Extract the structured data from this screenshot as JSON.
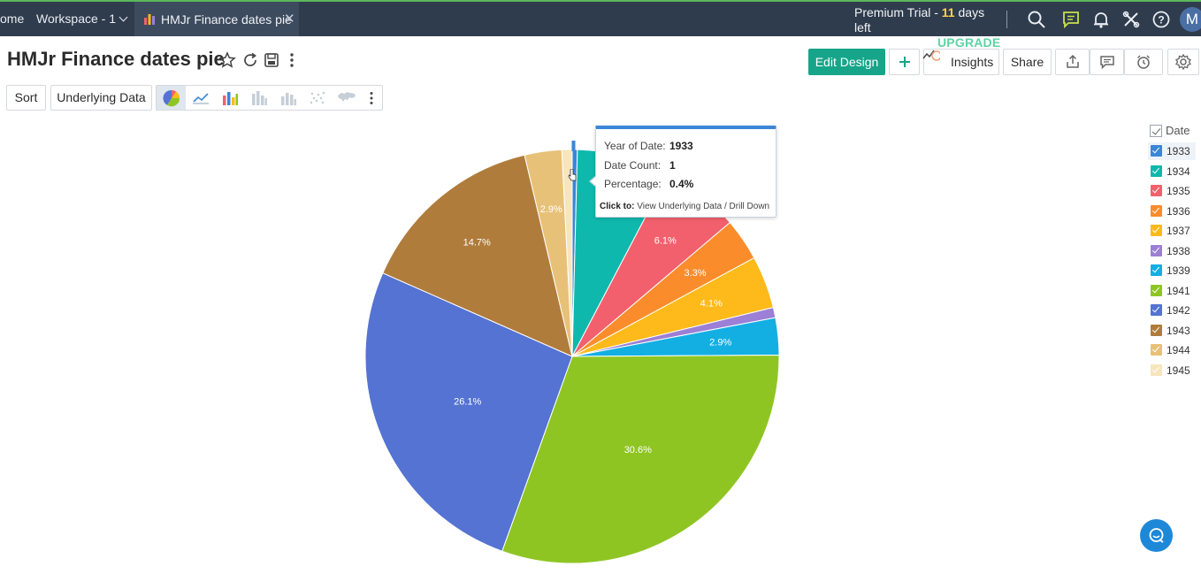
{
  "topbar": {
    "home_label": "ome",
    "workspace_label": "Workspace - 1",
    "tab_label": "HMJr Finance dates pie",
    "trial_prefix": "Premium Trial - ",
    "trial_days": "11",
    "trial_suffix": " days left",
    "upgrade_label": "UPGRADE",
    "avatar_letter": "M"
  },
  "header": {
    "title": "HMJr Finance dates pie",
    "edit_design_label": "Edit Design",
    "insights_label": "Insights",
    "share_label": "Share"
  },
  "toolbar": {
    "sort_label": "Sort",
    "underlying_data_label": "Underlying Data"
  },
  "tooltip": {
    "year_key": "Year of Date:",
    "year_value": "1933",
    "count_key": "Date Count:",
    "count_value": "1",
    "pct_key": "Percentage:",
    "pct_value": "0.4%",
    "click_prefix": "Click to:",
    "click_text": " View Underlying Data / Drill Down"
  },
  "chart_data": {
    "type": "pie",
    "title": "",
    "legend_title": "Date",
    "legend_position": "right",
    "slices": [
      {
        "label": "1933",
        "percent": 0.4,
        "color": "#3a86d7",
        "show_label": false
      },
      {
        "label": "1934",
        "percent": 7.3,
        "color": "#0fb8ad",
        "show_label": true
      },
      {
        "label": "1935",
        "percent": 6.1,
        "color": "#f2606d",
        "show_label": true
      },
      {
        "label": "1936",
        "percent": 3.3,
        "color": "#fb8c2c",
        "show_label": true
      },
      {
        "label": "1937",
        "percent": 4.1,
        "color": "#fdba1a",
        "show_label": true
      },
      {
        "label": "1938",
        "percent": 0.8,
        "color": "#9c7fd6",
        "show_label": false
      },
      {
        "label": "1939",
        "percent": 2.9,
        "color": "#13afe3",
        "show_label": true
      },
      {
        "label": "1941",
        "percent": 30.6,
        "color": "#8fc523",
        "show_label": true
      },
      {
        "label": "1942",
        "percent": 26.1,
        "color": "#5473d2",
        "show_label": true
      },
      {
        "label": "1943",
        "percent": 14.7,
        "color": "#b07c3c",
        "show_label": true
      },
      {
        "label": "1944",
        "percent": 2.9,
        "color": "#e8c178",
        "show_label": true
      },
      {
        "label": "1945",
        "percent": 0.8,
        "color": "#f6e5bd",
        "show_label": false
      }
    ]
  },
  "colors": {
    "topbar_bg": "#2f3c4d",
    "accent": "#17a589",
    "tooltip_accent": "#3b86d7",
    "help_bubble": "#1e88d8"
  }
}
